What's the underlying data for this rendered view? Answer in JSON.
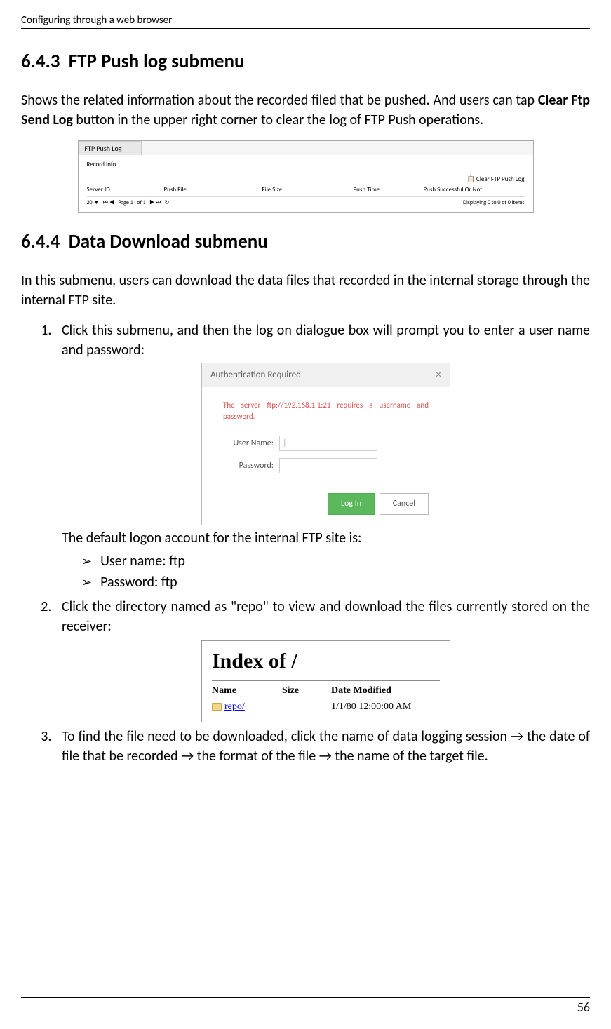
{
  "header": "Configuring through a web browser",
  "section1": {
    "number": "6.4.3",
    "title": "FTP Push log submenu",
    "paragraph_parts": {
      "p1": "Shows the related information about the recorded filed that be pushed. And users can tap ",
      "bold": "Clear Ftp Send Log",
      "p2": " button in the upper right corner to clear the log of FTP Push operations."
    }
  },
  "screenshot1": {
    "tab": "FTP Push Log",
    "record_info": "Record Info",
    "clear_button": "Clear FTP Push Log",
    "headers": {
      "server_id": "Server ID",
      "push_file": "Push File",
      "file_size": "File Size",
      "push_time": "Push Time",
      "push_success": "Push Successful Or Not"
    },
    "pager": {
      "page_size": "20",
      "page_label": "Page",
      "page_num": "1",
      "of": "of 1",
      "displaying": "Displaying 0 to 0 of 0 items"
    }
  },
  "section2": {
    "number": "6.4.4",
    "title": "Data Download submenu",
    "intro": "In this submenu, users can download the data files that recorded in the internal storage through the internal FTP site."
  },
  "list": {
    "item1": "Click this submenu, and then the log on dialogue box will prompt you to enter a user name and password:",
    "after_ss2": "The default logon account for the internal FTP site is:",
    "bullet1": "User name: ftp",
    "bullet2": "Password: ftp",
    "item2": "Click the directory named as \"repo\" to view and download the files currently stored on the receiver:",
    "item3": "To find the file need to be downloaded, click the name of data logging session → the date of file that be recorded → the format of the file → the name of the target file."
  },
  "screenshot2": {
    "title": "Authentication Required",
    "close": "×",
    "message": "The server ftp://192.168.1.1:21 requires a username and password.",
    "username_label": "User Name:",
    "username_cursor": "|",
    "password_label": "Password:",
    "login_btn": "Log In",
    "cancel_btn": "Cancel"
  },
  "screenshot3": {
    "title": "Index of /",
    "headers": {
      "name": "Name",
      "size": "Size",
      "date": "Date Modified"
    },
    "row": {
      "name": "repo/",
      "date": "1/1/80 12:00:00 AM"
    }
  },
  "page_number": "56"
}
